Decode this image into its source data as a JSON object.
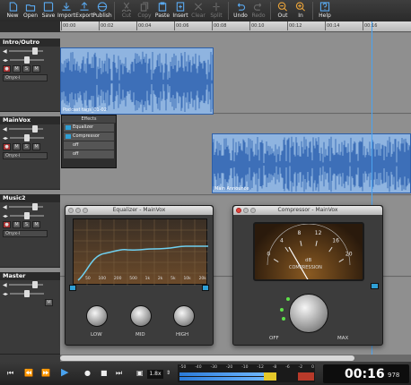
{
  "toolbar": {
    "items": [
      {
        "label": "New",
        "icon": "new-icon",
        "enabled": true
      },
      {
        "label": "Open",
        "icon": "open-icon",
        "enabled": true
      },
      {
        "label": "Save",
        "icon": "save-icon",
        "enabled": true
      },
      {
        "label": "Import",
        "icon": "import-icon",
        "enabled": true
      },
      {
        "label": "Export",
        "icon": "export-icon",
        "enabled": true
      },
      {
        "label": "Publish",
        "icon": "publish-icon",
        "enabled": true
      },
      {
        "label": "Cut",
        "icon": "cut-icon",
        "enabled": false
      },
      {
        "label": "Copy",
        "icon": "copy-icon",
        "enabled": false
      },
      {
        "label": "Paste",
        "icon": "paste-icon",
        "enabled": true
      },
      {
        "label": "Insert",
        "icon": "insert-icon",
        "enabled": true
      },
      {
        "label": "Clear",
        "icon": "clear-icon",
        "enabled": false
      },
      {
        "label": "Split",
        "icon": "split-icon",
        "enabled": false
      },
      {
        "label": "Undo",
        "icon": "undo-icon",
        "enabled": true
      },
      {
        "label": "Redo",
        "icon": "redo-icon",
        "enabled": false
      },
      {
        "label": "Out",
        "icon": "zoom-out-icon",
        "enabled": true
      },
      {
        "label": "In",
        "icon": "zoom-in-icon",
        "enabled": true
      },
      {
        "label": "Help",
        "icon": "help-icon",
        "enabled": true
      }
    ]
  },
  "ruler": {
    "ticks": [
      "00:00",
      "00:02",
      "00:04",
      "00:06",
      "00:08",
      "00:10",
      "00:12",
      "00:14",
      "00:16"
    ]
  },
  "tracks": [
    {
      "name": "Intro/Outro",
      "device": "Onyx-i"
    },
    {
      "name": "MainVox",
      "device": "Onyx-i"
    },
    {
      "name": "Music2",
      "device": "Onyx-i"
    },
    {
      "name": "Master",
      "device": ""
    }
  ],
  "clips": [
    {
      "label": "Podcast tags_01-02"
    },
    {
      "label": "Main Announce"
    }
  ],
  "effects_panel": {
    "title": "Effects",
    "items": [
      "Equalizer",
      "Compressor",
      "off",
      "off"
    ]
  },
  "equalizer": {
    "title": "Equalizer - MainVox",
    "knobs": [
      "LOW",
      "MID",
      "HIGH"
    ],
    "freqs": [
      "50",
      "100",
      "200",
      "500",
      "1k",
      "2k",
      "5k",
      "10k",
      "20k"
    ]
  },
  "compressor": {
    "title": "Compressor - MainVox",
    "meter_label": "dB",
    "meter_sub": "COMPRESSION",
    "scale": [
      "0",
      "4",
      "8",
      "12",
      "16",
      "20"
    ],
    "off_label": "OFF",
    "max_label": "MAX"
  },
  "transport": {
    "speed": "1.8x",
    "time": "00:16",
    "ms": "978",
    "meter_scale": [
      "-50",
      "-40",
      "-30",
      "-20",
      "-10",
      "-12",
      "-8",
      "-6",
      "-2",
      "0"
    ]
  },
  "colors": {
    "clip": "#7fa6d8",
    "clip_border": "#2d5fa8",
    "accent": "#2fa0d6",
    "playhead": "#4aa3f0"
  }
}
